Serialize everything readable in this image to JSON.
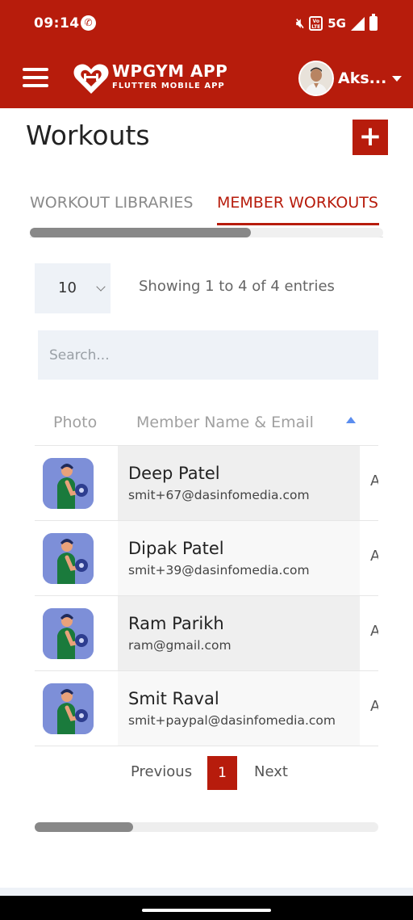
{
  "status_bar": {
    "time": "09:14",
    "network": "5G"
  },
  "app_bar": {
    "brand_title": "WPGYM APP",
    "brand_subtitle": "FLUTTER MOBILE APP",
    "username": "Aks..."
  },
  "page": {
    "title": "Workouts",
    "add_label": "+"
  },
  "tabs": [
    {
      "label": "WORKOUT LIBRARIES",
      "active": false
    },
    {
      "label": "MEMBER WORKOUTS",
      "active": true
    }
  ],
  "table_controls": {
    "entries_value": "10",
    "showing_text": "Showing 1 to 4 of 4 entries",
    "search_placeholder": "Search..."
  },
  "table": {
    "headers": [
      "Photo",
      "Member Name & Email"
    ],
    "sort": "ascending",
    "rows": [
      {
        "name": "Deep Patel",
        "email": "smit+67@dasinfomedia.com",
        "extra": "A"
      },
      {
        "name": "Dipak Patel",
        "email": "smit+39@dasinfomedia.com",
        "extra": "A"
      },
      {
        "name": "Ram Parikh",
        "email": "ram@gmail.com",
        "extra": "A"
      },
      {
        "name": "Smit Raval",
        "email": "smit+paypal@dasinfomedia.com",
        "extra": "A"
      }
    ]
  },
  "pagination": {
    "previous": "Previous",
    "current": "1",
    "next": "Next"
  },
  "colors": {
    "brand": "#b71c0c",
    "input_bg": "#eef2f7",
    "sort_icon": "#5b8def"
  },
  "icons": {
    "menu": "hamburger-icon",
    "logo": "heart-logo-icon",
    "dropdown": "caret-down-icon",
    "add": "plus-icon",
    "member_photo": "dumbbell-workout-icon"
  }
}
